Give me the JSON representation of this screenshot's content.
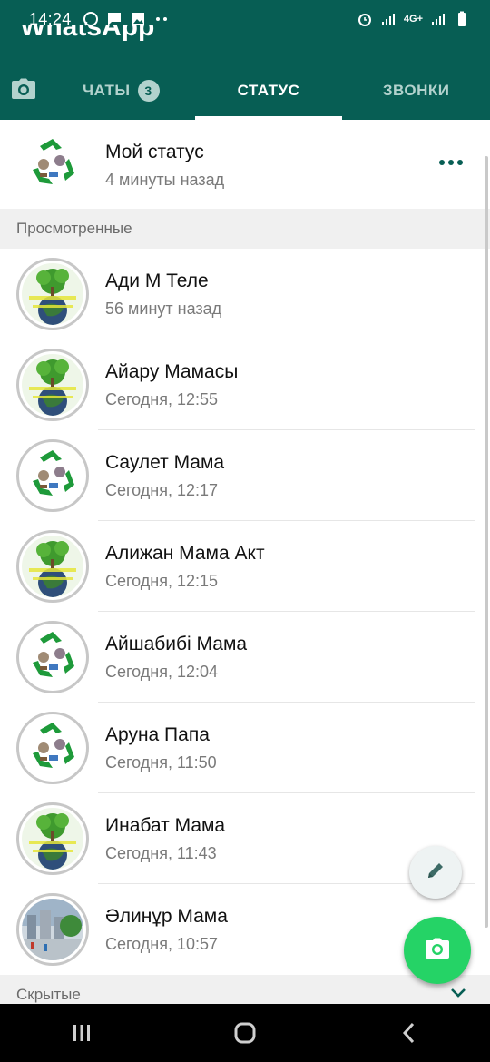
{
  "status_bar": {
    "time": "14:24",
    "network": "4G+",
    "icons": [
      "whatsapp-icon",
      "message-icon",
      "image-icon",
      "more-dots-icon",
      "alarm-icon",
      "signal-icon",
      "signal-icon",
      "battery-icon"
    ]
  },
  "app": {
    "title": "WhatsApp"
  },
  "tabs": [
    {
      "label": "ЧАТЫ",
      "badge": "3",
      "active": false
    },
    {
      "label": "СТАТУС",
      "active": true
    },
    {
      "label": "ЗВОНКИ",
      "active": false
    }
  ],
  "my_status": {
    "name": "Мой статус",
    "time": "4 минуты назад",
    "avatar": "recycle"
  },
  "sections": {
    "viewed": "Просмотренные",
    "hidden": "Скрытые"
  },
  "contacts": [
    {
      "name": "Ади М Теле",
      "time": "56 минут назад",
      "avatar": "tree"
    },
    {
      "name": "Айару Мамасы",
      "time": "Сегодня, 12:55",
      "avatar": "tree"
    },
    {
      "name": "Саулет Мама",
      "time": "Сегодня, 12:17",
      "avatar": "recycle"
    },
    {
      "name": "Алижан Мама Акт",
      "time": "Сегодня, 12:15",
      "avatar": "tree"
    },
    {
      "name": "Айшабибі Мама",
      "time": "Сегодня, 12:04",
      "avatar": "recycle"
    },
    {
      "name": "Аруна Папа",
      "time": "Сегодня, 11:50",
      "avatar": "recycle"
    },
    {
      "name": "Инабат Мама",
      "time": "Сегодня, 11:43",
      "avatar": "tree"
    },
    {
      "name": "Әлинұр Мама",
      "time": "Сегодня, 10:57",
      "avatar": "city"
    }
  ],
  "colors": {
    "header": "#075e54",
    "accent": "#25d366",
    "badge": "#b2d2cd"
  }
}
